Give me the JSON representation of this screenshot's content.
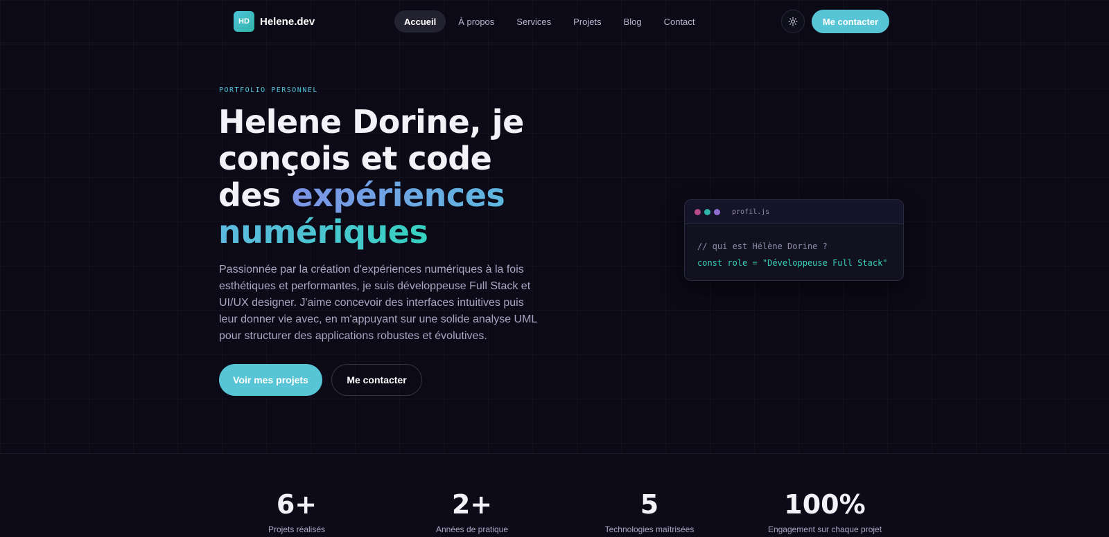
{
  "nav": {
    "brand_badge": "HD",
    "brand_name": "Helene.dev",
    "links": [
      {
        "label": "Accueil",
        "active": true
      },
      {
        "label": "À propos",
        "active": false
      },
      {
        "label": "Services",
        "active": false
      },
      {
        "label": "Projets",
        "active": false
      },
      {
        "label": "Blog",
        "active": false
      },
      {
        "label": "Contact",
        "active": false
      }
    ],
    "theme_icon": "sun-icon",
    "cta_label": "Me contacter"
  },
  "hero": {
    "eyebrow": "PORTFOLIO PERSONNEL",
    "title_plain": "Helene Dorine, je conçois et code des ",
    "title_gradient": "expériences numériques",
    "description": "Passionnée par la création d'expériences numériques à la fois esthétiques et performantes, je suis développeuse Full Stack et UI/UX designer. J'aime concevoir des interfaces intuitives puis leur donner vie avec, en m'appuyant sur une solide analyse UML pour structurer des applications robustes et évolutives.",
    "primary_button": "Voir mes projets",
    "secondary_button": "Me contacter"
  },
  "code_card": {
    "filename": "profil.js",
    "dot_colors": [
      "#b64a8a",
      "#2fb5a9",
      "#8e6fd1"
    ],
    "comment": "// qui est Hélène Dorine ?",
    "code": "const role = \"Développeuse Full Stack\""
  },
  "stats": [
    {
      "value": "6+",
      "label": "Projets réalisés"
    },
    {
      "value": "2+",
      "label": "Années de pratique"
    },
    {
      "value": "5",
      "label": "Technologies maîtrisées"
    },
    {
      "value": "100%",
      "label": "Engagement sur chaque projet"
    }
  ],
  "colors": {
    "background": "#0b0a16",
    "accent": "#58c5d6",
    "gradient_start": "#7d93e6",
    "gradient_end": "#36d2c0"
  }
}
